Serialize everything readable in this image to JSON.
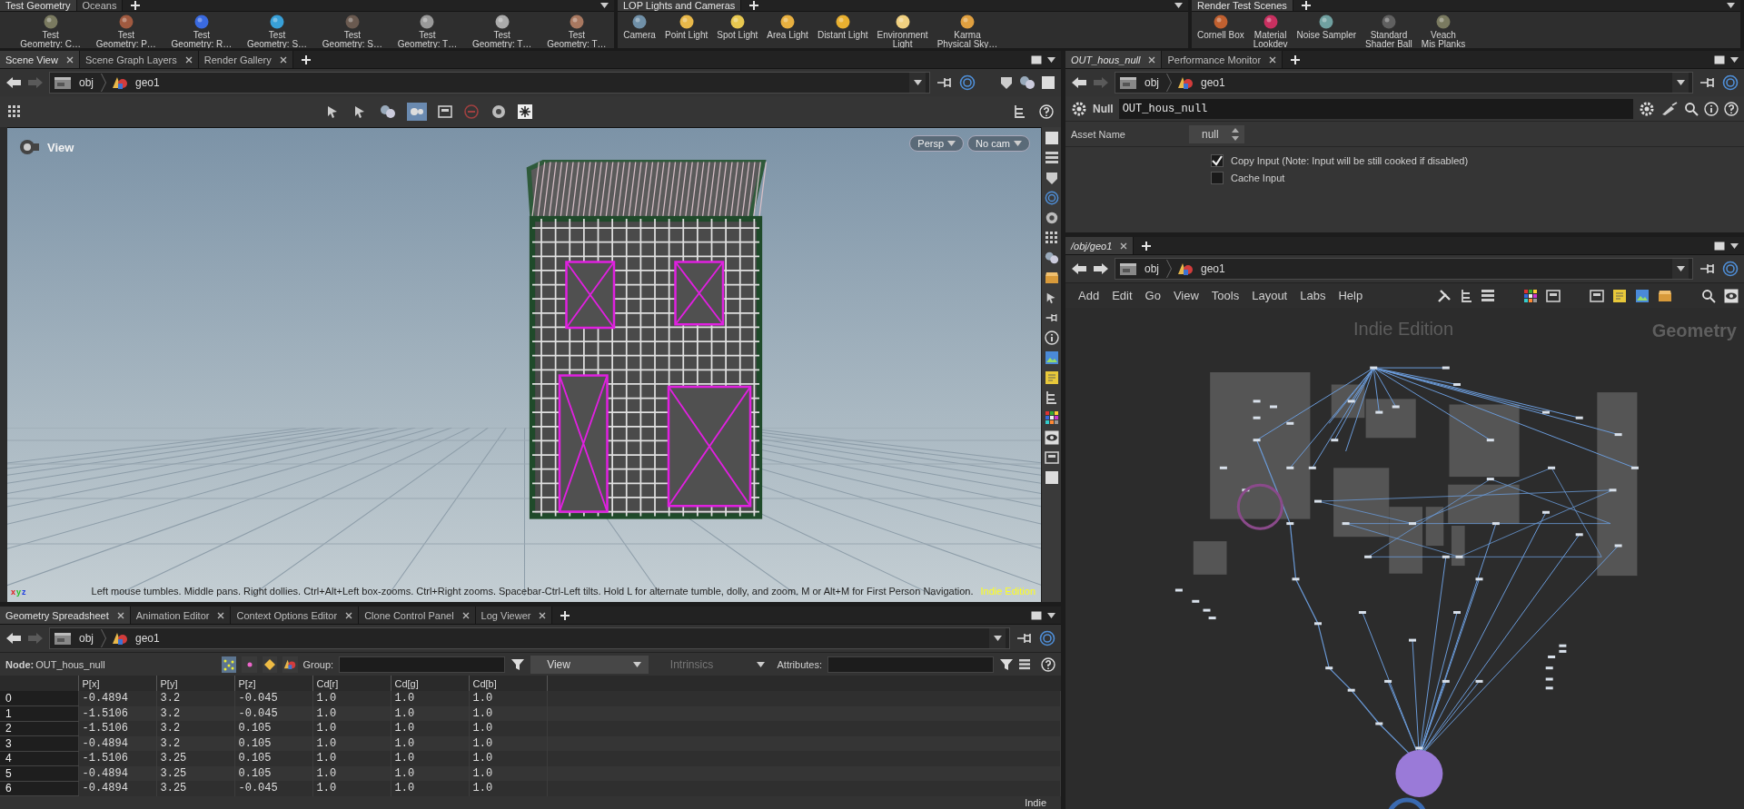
{
  "shelves": [
    {
      "tabs": [
        {
          "label": "Test Geometry",
          "selected": true
        },
        {
          "label": "Oceans",
          "selected": false
        }
      ],
      "tools": [
        "Test\nGeometry: C…",
        "Test\nGeometry: P…",
        "Test\nGeometry: R…",
        "Test\nGeometry: S…",
        "Test\nGeometry: S…",
        "Test\nGeometry: T…",
        "Test\nGeometry: T…",
        "Test\nGeometry: T…"
      ]
    },
    {
      "tabs": [
        {
          "label": "LOP Lights and Cameras",
          "selected": true
        }
      ],
      "tools": [
        "Camera",
        "Point Light",
        "Spot Light",
        "Area Light",
        "Distant Light",
        "Environment\nLight",
        "Karma\nPhysical Sky…"
      ]
    },
    {
      "tabs": [
        {
          "label": "Render Test Scenes",
          "selected": true
        }
      ],
      "tools": [
        "Cornell Box",
        "Material\nLookdev",
        "Noise Sampler",
        "Standard\nShader Ball",
        "Veach\nMis Planks"
      ]
    }
  ],
  "scene_view": {
    "tabs": [
      {
        "label": "Scene View",
        "selected": true
      },
      {
        "label": "Scene Graph Layers",
        "selected": false
      },
      {
        "label": "Render Gallery",
        "selected": false
      }
    ],
    "path": {
      "crumbs": [
        "obj",
        "geo1"
      ],
      "forward_disabled": true
    },
    "viewport": {
      "title": "View",
      "camera_buttons": [
        "Persp",
        "No cam"
      ],
      "axes": [
        "x",
        "y",
        "z"
      ],
      "hint": "Left mouse tumbles. Middle pans. Right dollies. Ctrl+Alt+Left box-zooms. Ctrl+Right zooms. Spacebar-Ctrl-Left tilts. Hold L for alternate tumble, dolly, and zoom. M or Alt+M for First Person Navigation.",
      "edition": "Indie Edition"
    }
  },
  "spreadsheet": {
    "tabs": [
      {
        "label": "Geometry Spreadsheet",
        "selected": true
      },
      {
        "label": "Animation Editor",
        "selected": false
      },
      {
        "label": "Context Options Editor",
        "selected": false
      },
      {
        "label": "Clone Control Panel",
        "selected": false
      },
      {
        "label": "Log Viewer",
        "selected": false
      }
    ],
    "path": {
      "crumbs": [
        "obj",
        "geo1"
      ],
      "forward_disabled": true
    },
    "node_label": "Node:",
    "node_name": "OUT_hous_null",
    "group_label": "Group:",
    "view_menu": {
      "label": "View",
      "disabled": false
    },
    "intrinsics_menu": {
      "label": "Intrinsics",
      "disabled": true
    },
    "attributes_label": "Attributes:",
    "columns": [
      "P[x]",
      "P[y]",
      "P[z]",
      "Cd[r]",
      "Cd[g]",
      "Cd[b]"
    ],
    "rows": [
      {
        "index": "0",
        "cells": [
          "-0.4894",
          "3.2",
          "-0.045",
          "1.0",
          "1.0",
          "1.0"
        ]
      },
      {
        "index": "1",
        "cells": [
          "-1.5106",
          "3.2",
          "-0.045",
          "1.0",
          "1.0",
          "1.0"
        ]
      },
      {
        "index": "2",
        "cells": [
          "-1.5106",
          "3.2",
          "0.105",
          "1.0",
          "1.0",
          "1.0"
        ]
      },
      {
        "index": "3",
        "cells": [
          "-0.4894",
          "3.2",
          "0.105",
          "1.0",
          "1.0",
          "1.0"
        ]
      },
      {
        "index": "4",
        "cells": [
          "-1.5106",
          "3.25",
          "0.105",
          "1.0",
          "1.0",
          "1.0"
        ]
      },
      {
        "index": "5",
        "cells": [
          "-0.4894",
          "3.25",
          "0.105",
          "1.0",
          "1.0",
          "1.0"
        ]
      },
      {
        "index": "6",
        "cells": [
          "-0.4894",
          "3.25",
          "-0.045",
          "1.0",
          "1.0",
          "1.0"
        ]
      }
    ],
    "corner_note": "Indie"
  },
  "parameters": {
    "tabs": [
      {
        "label": "OUT_hous_null",
        "selected": true,
        "kind": "node"
      },
      {
        "label": "Performance Monitor",
        "selected": false,
        "kind": "pane"
      }
    ],
    "path": {
      "crumbs": [
        "obj",
        "geo1"
      ],
      "forward_disabled": true
    },
    "node_type": "Null",
    "node_name": "OUT_hous_null",
    "asset_name_label": "Asset Name",
    "asset_name": "null",
    "toggles": [
      {
        "label": "Copy Input (Note: Input will be still cooked if disabled)",
        "checked": true
      },
      {
        "label": "Cache Input",
        "checked": false
      }
    ]
  },
  "network": {
    "tabs": [
      {
        "label": "/obj/geo1",
        "selected": true,
        "kind": "node"
      }
    ],
    "path": {
      "crumbs": [
        "obj",
        "geo1"
      ],
      "forward_disabled": false
    },
    "menu": [
      "Add",
      "Edit",
      "Go",
      "View",
      "Tools",
      "Layout",
      "Labs",
      "Help"
    ],
    "watermark": "Indie Edition",
    "context": "Geometry"
  }
}
